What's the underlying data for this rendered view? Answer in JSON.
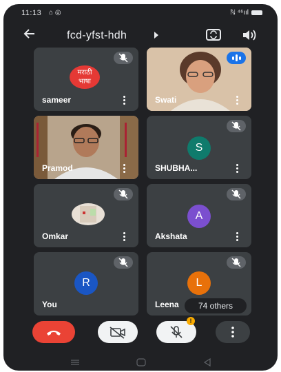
{
  "status": {
    "time": "11:13",
    "signal": "ℕ ⁴⁶ııl"
  },
  "header": {
    "title": "fcd-yfst-hdh"
  },
  "tiles": [
    {
      "name": "sameer",
      "logo_top": "मराठी",
      "logo_bottom": "भाषा"
    },
    {
      "name": "Swati"
    },
    {
      "name": "Pramod"
    },
    {
      "name": "SHUBHA...",
      "initial": "S"
    },
    {
      "name": "Omkar"
    },
    {
      "name": "Akshata",
      "initial": "A"
    },
    {
      "name": "You",
      "initial": "R"
    },
    {
      "name": "Leena",
      "initial": "L"
    }
  ],
  "others_label": "74 others",
  "notification_badge": "!",
  "colors": {
    "bg": "#202124",
    "tile": "#3c4043",
    "teal": "#0f7b6c",
    "purple": "#7b4fcf",
    "blue": "#1a56c4",
    "orange": "#e8710a",
    "end_call": "#ea4335"
  }
}
